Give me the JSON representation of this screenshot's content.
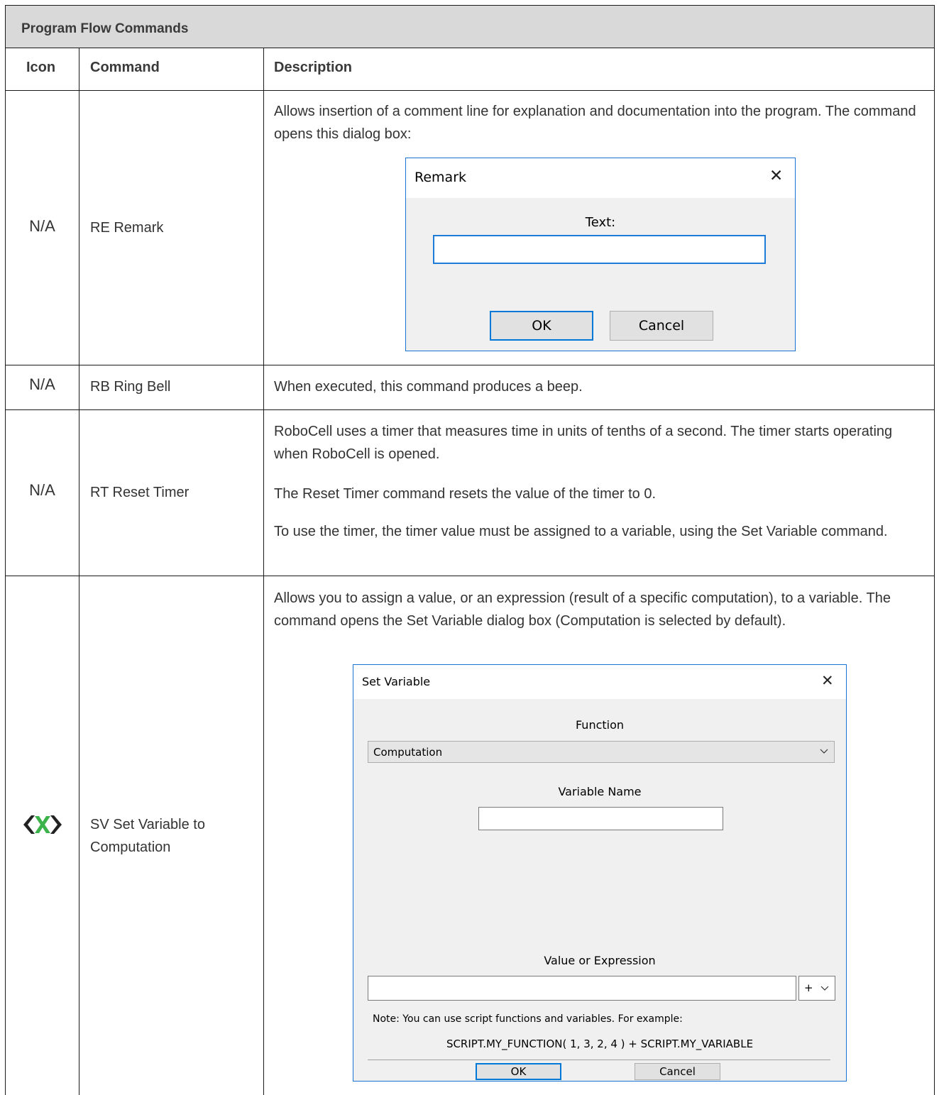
{
  "table": {
    "title": "Program Flow Commands",
    "headers": {
      "icon": "Icon",
      "command": "Command",
      "description": "Description"
    },
    "rows": [
      {
        "icon": "N/A",
        "command": "RE Remark",
        "description": [
          "Allows insertion of a comment line for explanation and documentation into the program. The command opens this dialog box:"
        ]
      },
      {
        "icon": "N/A",
        "command": "RB Ring Bell",
        "description": [
          "When executed, this command produces a beep."
        ]
      },
      {
        "icon": "N/A",
        "command": "RT Reset Timer",
        "description": [
          "RoboCell uses a timer that measures time in units of tenths of a second. The timer starts operating when RoboCell is opened.",
          "The Reset Timer command resets the value of the timer to 0.",
          "To use the timer, the timer value must be assigned to a variable, using the Set Variable command."
        ]
      },
      {
        "icon": "set-variable-icon",
        "command": "SV Set Variable to Computation",
        "description": [
          "Allows you to assign a value, or an expression (result of a specific computation), to a variable. The command opens the Set Variable dialog box (Computation is selected by default)."
        ]
      }
    ]
  },
  "remark_dialog": {
    "title": "Remark",
    "close_glyph": "✕",
    "text_label": "Text:",
    "text_value": "",
    "ok": "OK",
    "cancel": "Cancel"
  },
  "set_variable_dialog": {
    "title": "Set Variable",
    "close_glyph": "✕",
    "function_label": "Function",
    "function_selected": "Computation",
    "variable_name_label": "Variable Name",
    "variable_name_value": "",
    "value_label": "Value  or  Expression",
    "value_value": "",
    "operator_selected": "+",
    "note": "Note: You can use script functions and variables. For example:",
    "example": "SCRIPT.MY_FUNCTION( 1, 3, 2, 4 ) + SCRIPT.MY_VARIABLE",
    "ok": "OK",
    "cancel": "Cancel"
  },
  "colors": {
    "title_bar": "#d9d9d9",
    "dialog_border": "#1874d2",
    "icon_green": "#3cb24a",
    "icon_dark": "#222222"
  }
}
